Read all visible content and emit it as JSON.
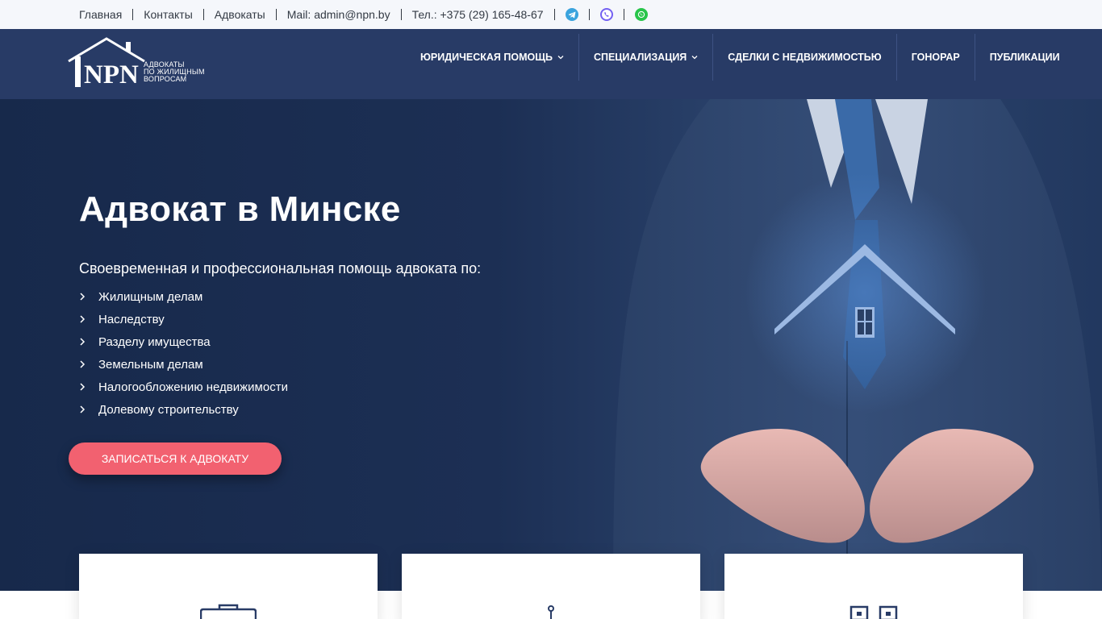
{
  "topbar": {
    "links": [
      "Главная",
      "Контакты",
      "Адвокаты"
    ],
    "mail": "Mail: admin@npn.by",
    "phone": "Тел.: +375 (29) 165-48-67",
    "social_icons": [
      "telegram-icon",
      "viber-icon",
      "whatsapp-icon"
    ]
  },
  "logo": {
    "brand": "NPN",
    "tagline": [
      "АДВОКАТЫ",
      "ПО ЖИЛИЩНЫМ",
      "ВОПРОСАМ"
    ]
  },
  "nav": {
    "items": [
      {
        "label": "ЮРИДИЧЕСКАЯ ПОМОЩЬ",
        "has_dropdown": true
      },
      {
        "label": "СПЕЦИАЛИЗАЦИЯ",
        "has_dropdown": true
      },
      {
        "label": "СДЕЛКИ С НЕДВИЖИМОСТЬЮ",
        "has_dropdown": false
      },
      {
        "label": "ГОНОРАР",
        "has_dropdown": false
      },
      {
        "label": "ПУБЛИКАЦИИ",
        "has_dropdown": false
      }
    ]
  },
  "hero": {
    "title": "Адвокат в Минске",
    "subtitle": "Своевременная и профессиональная помощь адвоката по:",
    "list": [
      "Жилищным делам",
      "Наследству",
      "Разделу имущества",
      "Земельным делам",
      "Налогообложению недвижимости",
      "Долевому строительству"
    ],
    "cta": "ЗАПИСАТЬСЯ К АДВОКАТУ"
  },
  "cards": {
    "icons": [
      "briefcase-icon",
      "pin-icon",
      "houses-icon"
    ]
  },
  "colors": {
    "topbar_bg": "#f5f7fb",
    "header_bg": "#283b66",
    "hero_bg": "#1c2f54",
    "accent": "#f26170",
    "text_dark": "#333a44"
  }
}
